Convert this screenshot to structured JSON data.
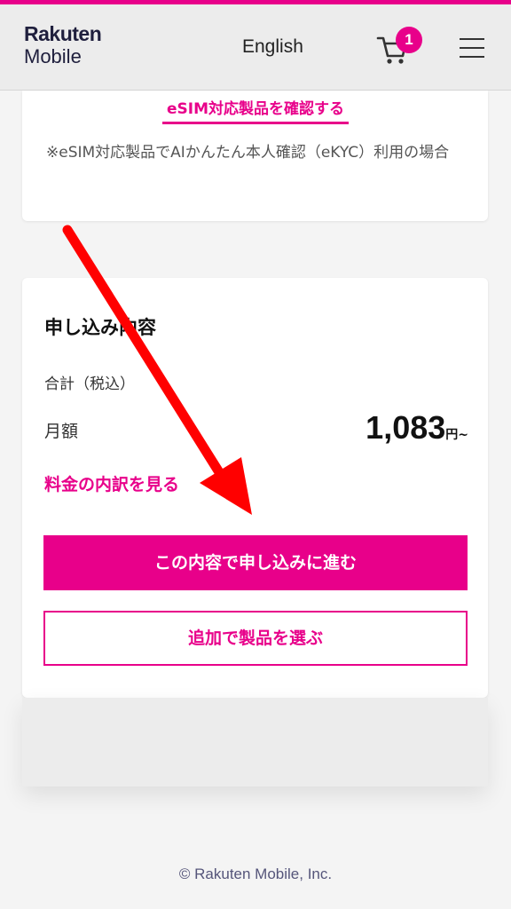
{
  "header": {
    "logo_line1": "Rakuten",
    "logo_line2": "Mobile",
    "language_label": "English",
    "cart_count": "1"
  },
  "esim_card": {
    "link_label": "eSIM対応製品を確認する",
    "note": "※eSIM対応製品でAIかんたん本人確認（eKYC）利用の場合"
  },
  "summary": {
    "title": "申し込み内容",
    "total_label": "合計（税込）",
    "monthly_label": "月額",
    "price_value": "1,083",
    "price_unit": "円~",
    "breakdown_link": "料金の内訳を見る",
    "primary_button": "この内容で申し込みに進む",
    "secondary_button": "追加で製品を選ぶ"
  },
  "footer": {
    "copyright": "© Rakuten Mobile, Inc."
  },
  "colors": {
    "brand": "#e8008a",
    "annotation_arrow": "#ff0000"
  },
  "icons": {
    "cart": "shopping-cart-icon",
    "menu": "hamburger-menu-icon"
  }
}
